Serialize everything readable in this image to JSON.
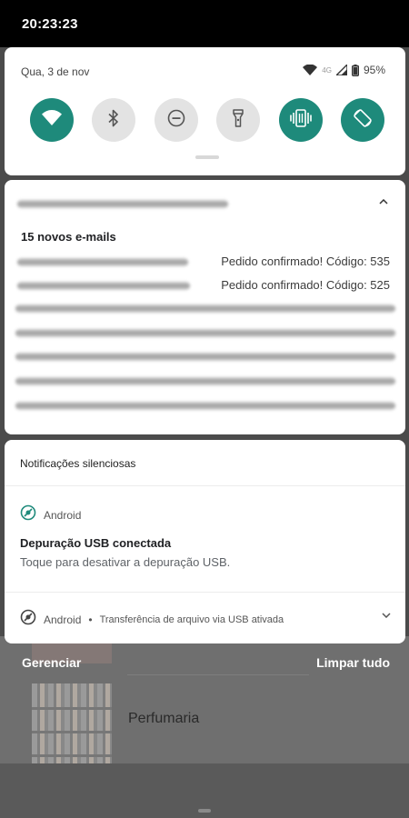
{
  "status_bar": {
    "time": "20:23:23"
  },
  "quick_settings": {
    "date": "Qua, 3 de nov",
    "network": "4G",
    "battery": "95%",
    "tiles": [
      {
        "name": "wifi",
        "active": true
      },
      {
        "name": "bluetooth",
        "active": false
      },
      {
        "name": "do-not-disturb",
        "active": false
      },
      {
        "name": "flashlight",
        "active": false
      },
      {
        "name": "vibrate",
        "active": true
      },
      {
        "name": "auto-rotate",
        "active": true
      }
    ]
  },
  "email_notification": {
    "summary": "15 novos e-mails",
    "items": [
      {
        "subject": "Pedido confirmado! Código: 535"
      },
      {
        "subject": "Pedido confirmado! Código: 525"
      }
    ]
  },
  "silent_section": {
    "header": "Notificações silenciosas",
    "notifications": [
      {
        "app": "Android",
        "title": "Depuração USB conectada",
        "text": "Toque para desativar a depuração USB."
      },
      {
        "app": "Android",
        "separator": "•",
        "detail": "Transferência de arquivo via USB ativada"
      }
    ]
  },
  "footer": {
    "manage": "Gerenciar",
    "clear_all": "Limpar tudo"
  },
  "background_app": {
    "item_label": "Perfumaria"
  },
  "colors": {
    "accent": "#1e8a7b",
    "panel": "#ffffff",
    "scrim": "#4b4b4b"
  }
}
